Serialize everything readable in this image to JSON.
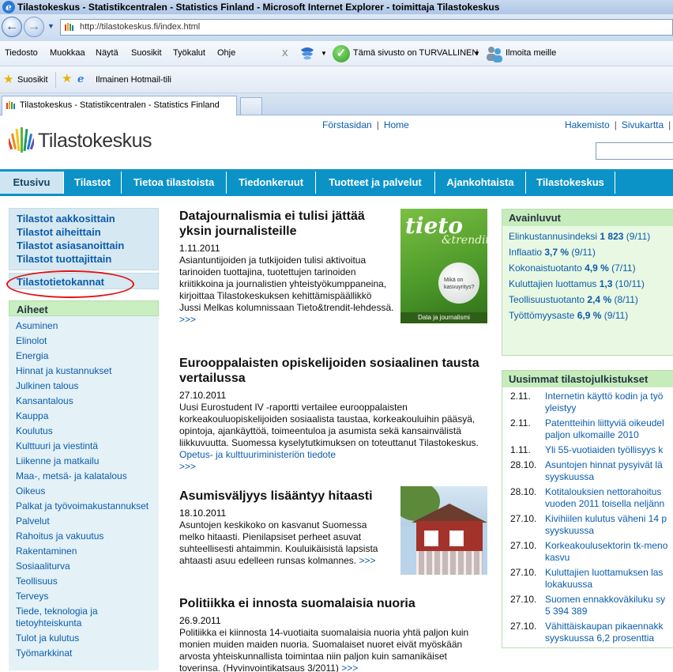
{
  "window": {
    "title": "Tilastokeskus - Statistikcentralen - Statistics Finland - Microsoft Internet Explorer - toimittaja Tilastokeskus",
    "url": "http://tilastokeskus.fi/index.html"
  },
  "menubar": {
    "items": [
      "Tiedosto",
      "Muokkaa",
      "Näytä",
      "Suosikit",
      "Työkalut",
      "Ohje"
    ],
    "close_glyph": "x",
    "safety_status": "Tämä sivusto on TURVALLINEN",
    "report_label": "Ilmoita meille"
  },
  "favorites": {
    "label": "Suosikit",
    "items": [
      "Ilmainen Hotmail-tili"
    ]
  },
  "tabs": {
    "active_title": "Tilastokeskus - Statistikcentralen - Statistics Finland"
  },
  "site": {
    "logo_text": "Tilastokeskus",
    "top_links": [
      "Förstasidan",
      "Home"
    ],
    "top_right_links": [
      "Hakemisto",
      "Sivukartta"
    ],
    "separator": "|"
  },
  "nav": {
    "tabs": [
      "Etusivu",
      "Tilastot",
      "Tietoa tilastoista",
      "Tiedonkeruut",
      "Tuotteet ja palvelut",
      "Ajankohtaista",
      "Tilastokeskus"
    ]
  },
  "left": {
    "quick_links": [
      "Tilastot aakkosittain",
      "Tilastot aiheittain",
      "Tilastot asiasanoittain",
      "Tilastot tuottajittain"
    ],
    "db_link": "Tilastotietokannat",
    "topics_title": "Aiheet",
    "topics": [
      "Asuminen",
      "Elinolot",
      "Energia",
      "Hinnat ja kustannukset",
      "Julkinen talous",
      "Kansantalous",
      "Kauppa",
      "Koulutus",
      "Kulttuuri ja viestintä",
      "Liikenne ja matkailu",
      "Maa-, metsä- ja kalatalous",
      "Oikeus",
      "Palkat ja työvoimakustannukset",
      "Palvelut",
      "Rahoitus ja vakuutus",
      "Rakentaminen",
      "Sosiaaliturva",
      "Teollisuus",
      "Terveys",
      "Tiede, teknologia ja tietoyhteiskunta",
      "Tulot ja kulutus",
      "Työmarkkinat"
    ]
  },
  "articles": [
    {
      "title": "Datajournalismia ei tulisi jättää yksin journalisteille",
      "date": "1.11.2011",
      "body": "Asiantuntijoiden ja tutkijoiden tulisi aktivoitua tarinoiden tuottajina, tuotettujen tarinoiden kriitikkoina ja journalistien yhteistyökumppaneina, kirjoittaa Tilastokeskuksen kehittämispäällikkö Jussi Melkas kolumnissaan Tieto&trendit-lehdessä.",
      "more": ">>>",
      "image": {
        "title": "tieto",
        "subtitle": "&trendit",
        "question": "Mikä on kasvuyritys?",
        "footer": "Data ja journalismi"
      }
    },
    {
      "title": "Eurooppalaisten opiskelijoiden sosiaalinen tausta vertailussa",
      "date": "27.10.2011",
      "body": "Uusi Eurostudent IV -raportti vertailee eurooppalaisten korkeakouluopiskelijoiden sosiaalista taustaa, korkeakouluihin pääsyä, opintoja, ajankäyttöä, toimeentuloa ja asumista sekä kansainvälistä liikkuvuutta. Suomessa kyselytutkimuksen on toteuttanut Tilastokeskus.",
      "link": "Opetus- ja kulttuuriministeriön tiedote",
      "more": ">>>"
    },
    {
      "title": "Asumisväljyys lisääntyy hitaasti",
      "date": "18.10.2011",
      "body": "Asuntojen keskikoko on kasvanut Suomessa melko hitaasti. Pienilapsiset perheet asuvat suhteellisesti ahtaimmin. Kouluikäisistä lapsista ahtaasti asuu edelleen runsas kolmannes.",
      "more": ">>>"
    },
    {
      "title": "Politiikka ei innosta suomalaisia nuoria",
      "date": "26.9.2011",
      "body": "Politiikka ei kiinnosta 14-vuotiaita suomalaisia nuoria yhtä paljon kuin monien muiden maiden nuoria. Suomalaiset nuoret eivät myöskään arvosta yhteiskunnallista toimintaa niin paljon kuin samanikäiset toverinsa. (Hyvinvointikatsaus 3/2011)",
      "more": ">>>"
    }
  ],
  "key_figures": {
    "title": "Avainluvut",
    "items": [
      {
        "label": "Elinkustannusindeksi",
        "value": "1 823",
        "period": "(9/11)"
      },
      {
        "label": "Inflaatio",
        "value": "3,7 %",
        "period": "(9/11)"
      },
      {
        "label": "Kokonaistuotanto",
        "value": "4,9 %",
        "period": "(7/11)"
      },
      {
        "label": "Kuluttajien luottamus",
        "value": "1,3",
        "period": "(10/11)"
      },
      {
        "label": "Teollisuustuotanto",
        "value": "2,4 %",
        "period": "(8/11)"
      },
      {
        "label": "Työttömyysaste",
        "value": "6,9 %",
        "period": "(9/11)"
      }
    ]
  },
  "newest": {
    "title": "Uusimmat tilastojulkistukset",
    "items": [
      {
        "date": "2.11.",
        "lines": [
          "Internetin käyttö kodin ja työ",
          "yleistyy"
        ]
      },
      {
        "date": "2.11.",
        "lines": [
          "Patentteihin liittyviä oikeudel",
          "paljon ulkomaille 2010"
        ]
      },
      {
        "date": "1.11.",
        "lines": [
          "Yli 55-vuotiaiden työllisyys k"
        ]
      },
      {
        "date": "28.10.",
        "lines": [
          "Asuntojen hinnat pysyivät lä",
          "syyskuussa"
        ]
      },
      {
        "date": "28.10.",
        "lines": [
          "Kotitalouksien nettorahoitus",
          "vuoden 2011 toisella neljänn"
        ]
      },
      {
        "date": "27.10.",
        "lines": [
          "Kivihiilen kulutus väheni 14 p",
          "syyskuussa"
        ]
      },
      {
        "date": "27.10.",
        "lines": [
          "Korkeakoulusektorin tk-meno",
          "kasvu"
        ]
      },
      {
        "date": "27.10.",
        "lines": [
          "Kuluttajien luottamuksen las",
          "lokakuussa"
        ]
      },
      {
        "date": "27.10.",
        "lines": [
          "Suomen ennakkoväkiluku sy",
          "5 394 389"
        ]
      },
      {
        "date": "27.10.",
        "lines": [
          "Vähittäiskaupan pikaennakk",
          "syyskuussa 6,2 prosenttia"
        ]
      }
    ]
  },
  "colors": {
    "nav_blue": "#0b93c8",
    "link_blue": "#0b5cab",
    "box_green": "#c6ecbb",
    "box_blue": "#d6e8f1",
    "annotation_red": "#e11212"
  }
}
